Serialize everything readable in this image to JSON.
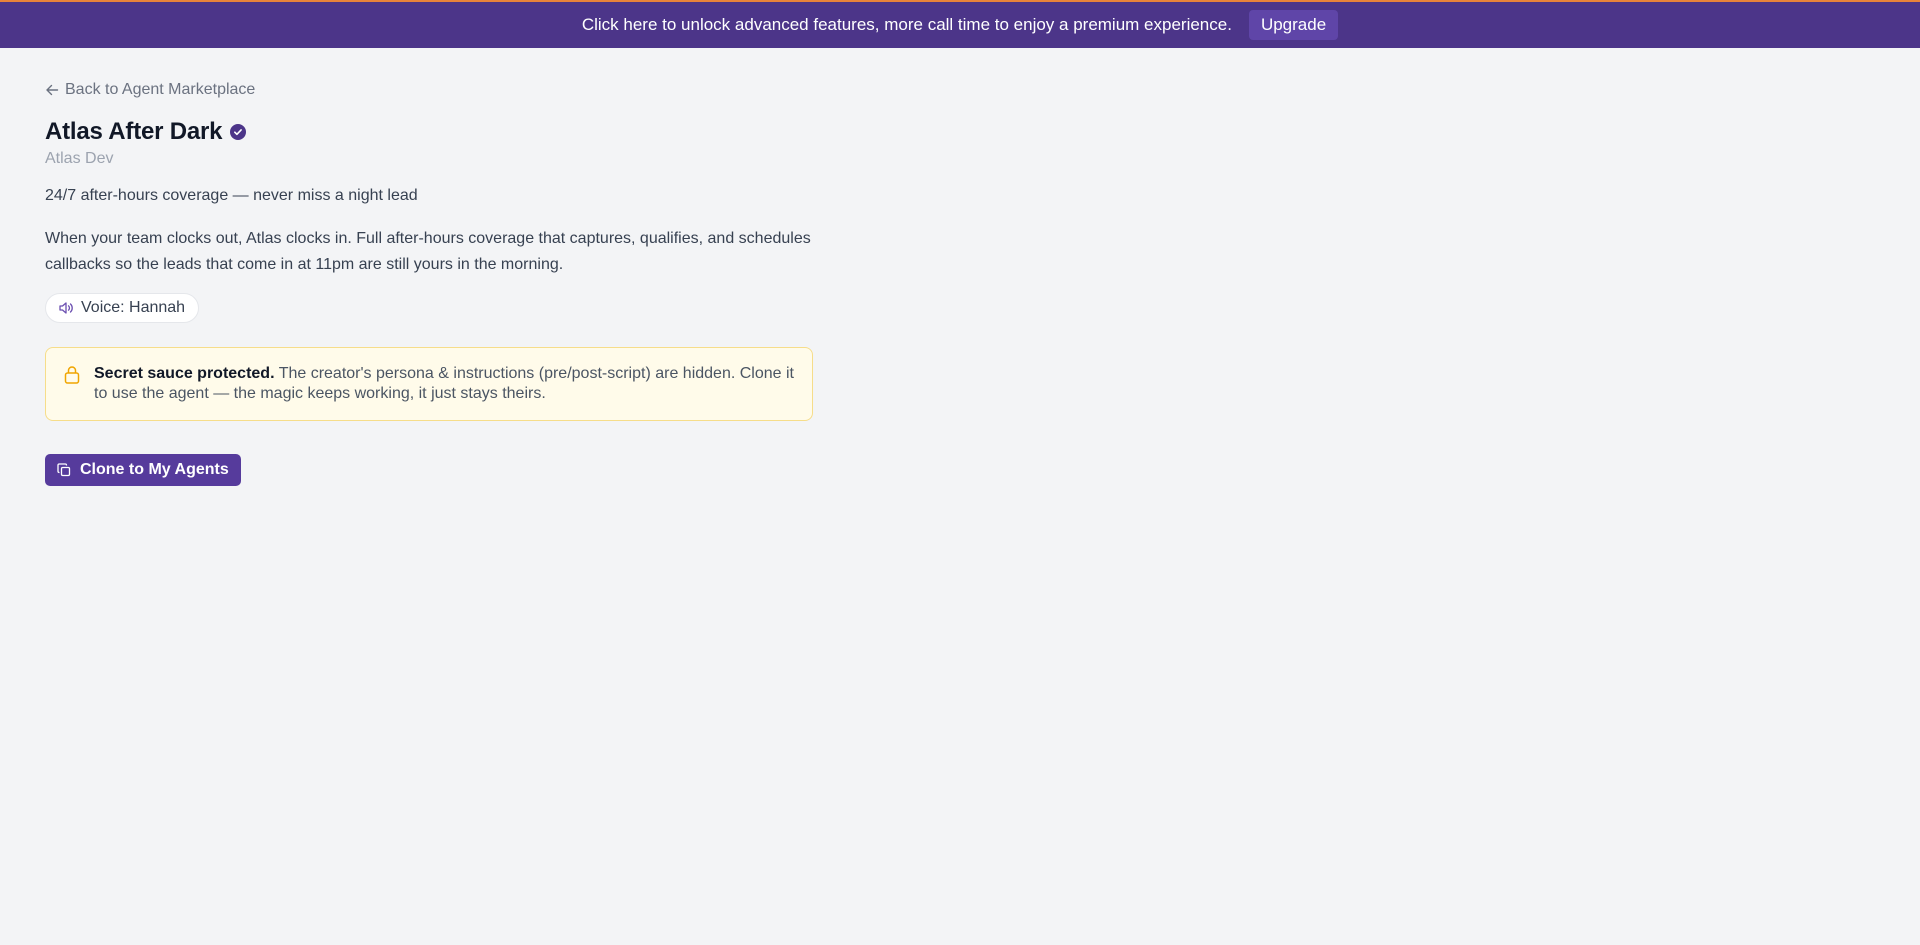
{
  "banner": {
    "message": "Click here to unlock advanced features, more call time to enjoy a premium experience.",
    "upgrade_label": "Upgrade",
    "background": "#4c3589",
    "accent": "#e8833a"
  },
  "nav": {
    "back_label": "Back to Agent Marketplace",
    "back_icon": "arrow-left-icon"
  },
  "agent": {
    "title": "Atlas After Dark",
    "verified_icon": "verified-badge-icon",
    "creator": "Atlas Dev",
    "tagline": "24/7 after-hours coverage — never miss a night lead",
    "description": "When your team clocks out, Atlas clocks in. Full after-hours coverage that captures, qualifies, and schedules callbacks so the leads that come in at 11pm are still yours in the morning.",
    "voice_label": "Voice: Hannah",
    "voice_icon": "speaker-icon"
  },
  "notice": {
    "icon": "lock-icon",
    "strong": "Secret sauce protected.",
    "text": "The creator's persona & instructions (pre/post-script) are hidden. Clone it to use the agent — the magic keeps working, it just stays theirs.",
    "background": "#fffbea",
    "border": "#f6dd8a"
  },
  "actions": {
    "clone_label": "Clone to My Agents",
    "clone_icon": "copy-icon",
    "primary_color": "#563b9c"
  }
}
